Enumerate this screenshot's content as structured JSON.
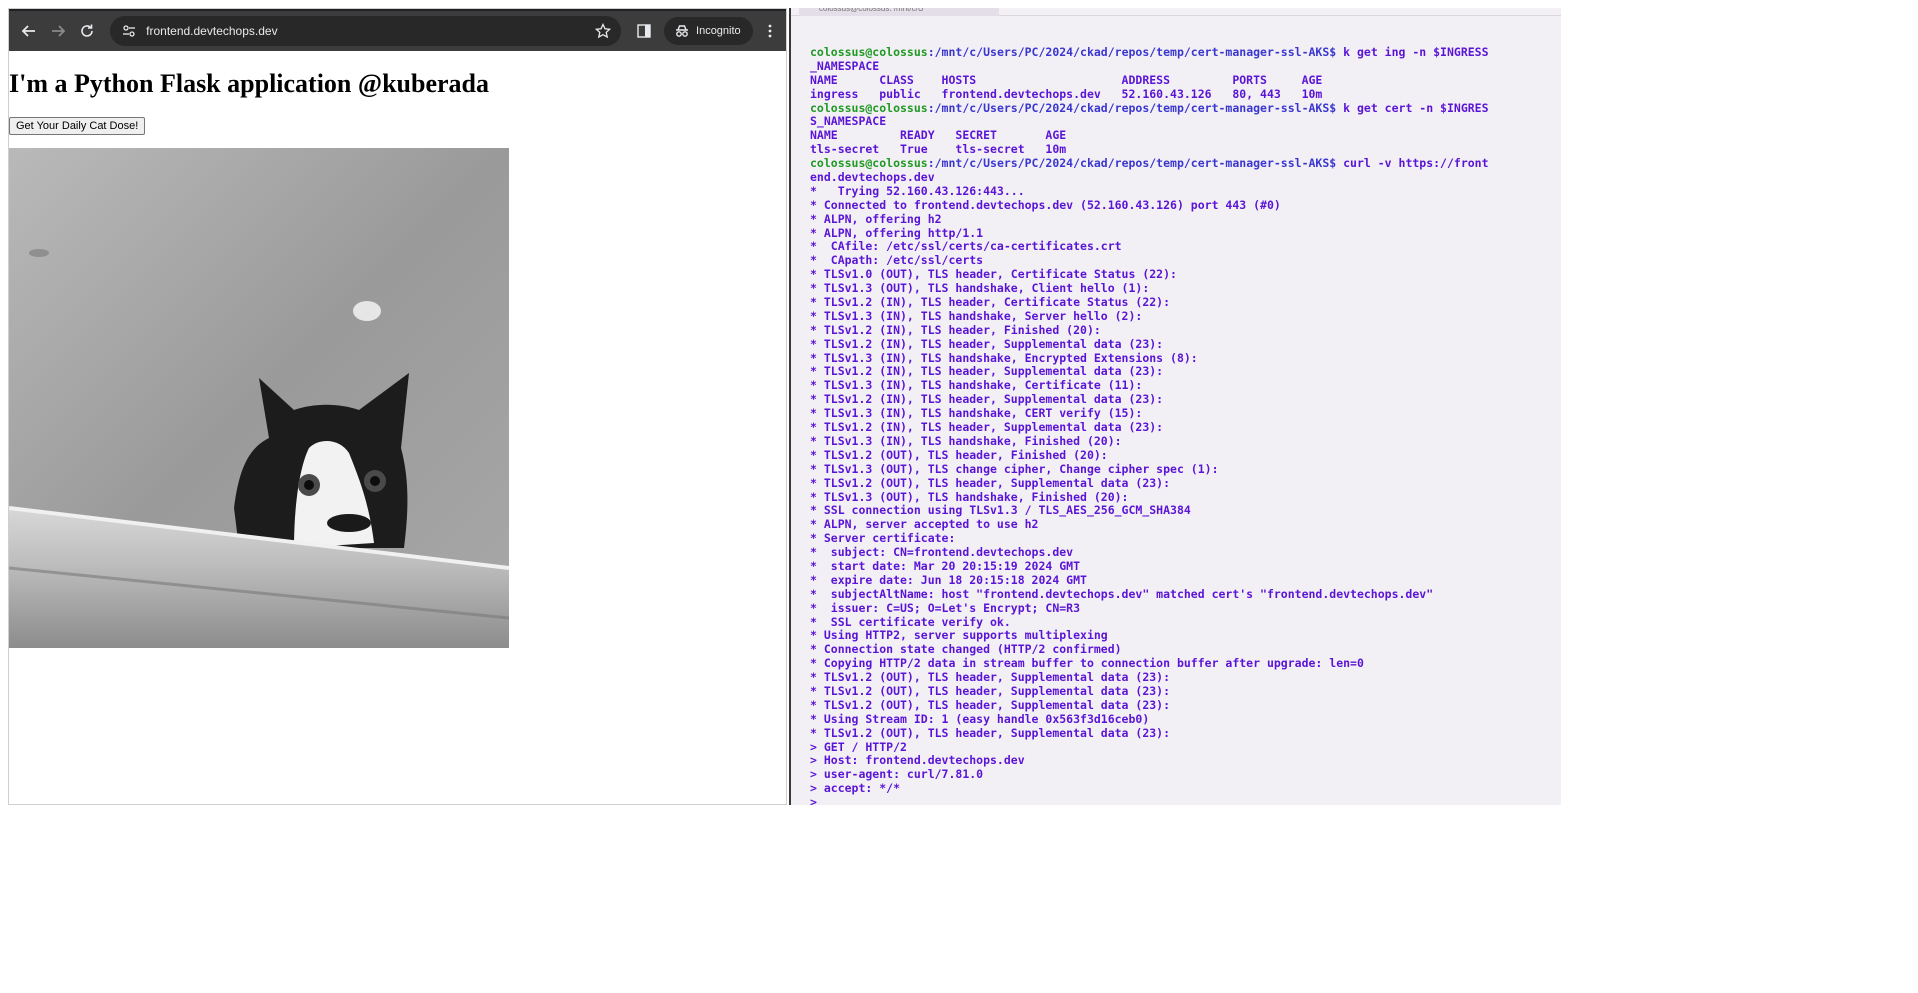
{
  "browser": {
    "url": "frontend.devtechops.dev",
    "mode_label": "Incognito",
    "page": {
      "heading": "I'm a Python Flask application @kuberada",
      "button_label": "Get Your Daily Cat Dose!"
    }
  },
  "terminal": {
    "tab_title": "colossus@colossus: /mnt/c/U",
    "prompt_user": "colossus@colossus",
    "lines": [
      {
        "kind": "prompt",
        "path": ":/mnt/c/Users/PC/2024/ckad/repos/temp/cert-manager-ssl-AKS$",
        "cmd": " k get ing -n $INGRESS"
      },
      {
        "kind": "text",
        "text": "_NAMESPACE"
      },
      {
        "kind": "text",
        "text": "NAME      CLASS    HOSTS                     ADDRESS         PORTS     AGE"
      },
      {
        "kind": "text",
        "text": "ingress   public   frontend.devtechops.dev   52.160.43.126   80, 443   10m"
      },
      {
        "kind": "prompt",
        "path": ":/mnt/c/Users/PC/2024/ckad/repos/temp/cert-manager-ssl-AKS$",
        "cmd": " k get cert -n $INGRES"
      },
      {
        "kind": "text",
        "text": "S_NAMESPACE"
      },
      {
        "kind": "text",
        "text": "NAME         READY   SECRET       AGE"
      },
      {
        "kind": "text",
        "text": "tls-secret   True    tls-secret   10m"
      },
      {
        "kind": "prompt",
        "path": ":/mnt/c/Users/PC/2024/ckad/repos/temp/cert-manager-ssl-AKS$",
        "cmd": " curl -v https://front"
      },
      {
        "kind": "text",
        "text": "end.devtechops.dev"
      },
      {
        "kind": "text",
        "text": "*   Trying 52.160.43.126:443..."
      },
      {
        "kind": "text",
        "text": "* Connected to frontend.devtechops.dev (52.160.43.126) port 443 (#0)"
      },
      {
        "kind": "text",
        "text": "* ALPN, offering h2"
      },
      {
        "kind": "text",
        "text": "* ALPN, offering http/1.1"
      },
      {
        "kind": "text",
        "text": "*  CAfile: /etc/ssl/certs/ca-certificates.crt"
      },
      {
        "kind": "text",
        "text": "*  CApath: /etc/ssl/certs"
      },
      {
        "kind": "text",
        "text": "* TLSv1.0 (OUT), TLS header, Certificate Status (22):"
      },
      {
        "kind": "text",
        "text": "* TLSv1.3 (OUT), TLS handshake, Client hello (1):"
      },
      {
        "kind": "text",
        "text": "* TLSv1.2 (IN), TLS header, Certificate Status (22):"
      },
      {
        "kind": "text",
        "text": "* TLSv1.3 (IN), TLS handshake, Server hello (2):"
      },
      {
        "kind": "text",
        "text": "* TLSv1.2 (IN), TLS header, Finished (20):"
      },
      {
        "kind": "text",
        "text": "* TLSv1.2 (IN), TLS header, Supplemental data (23):"
      },
      {
        "kind": "text",
        "text": "* TLSv1.3 (IN), TLS handshake, Encrypted Extensions (8):"
      },
      {
        "kind": "text",
        "text": "* TLSv1.2 (IN), TLS header, Supplemental data (23):"
      },
      {
        "kind": "text",
        "text": "* TLSv1.3 (IN), TLS handshake, Certificate (11):"
      },
      {
        "kind": "text",
        "text": "* TLSv1.2 (IN), TLS header, Supplemental data (23):"
      },
      {
        "kind": "text",
        "text": "* TLSv1.3 (IN), TLS handshake, CERT verify (15):"
      },
      {
        "kind": "text",
        "text": "* TLSv1.2 (IN), TLS header, Supplemental data (23):"
      },
      {
        "kind": "text",
        "text": "* TLSv1.3 (IN), TLS handshake, Finished (20):"
      },
      {
        "kind": "text",
        "text": "* TLSv1.2 (OUT), TLS header, Finished (20):"
      },
      {
        "kind": "text",
        "text": "* TLSv1.3 (OUT), TLS change cipher, Change cipher spec (1):"
      },
      {
        "kind": "text",
        "text": "* TLSv1.2 (OUT), TLS header, Supplemental data (23):"
      },
      {
        "kind": "text",
        "text": "* TLSv1.3 (OUT), TLS handshake, Finished (20):"
      },
      {
        "kind": "text",
        "text": "* SSL connection using TLSv1.3 / TLS_AES_256_GCM_SHA384"
      },
      {
        "kind": "text",
        "text": "* ALPN, server accepted to use h2"
      },
      {
        "kind": "text",
        "text": "* Server certificate:"
      },
      {
        "kind": "text",
        "text": "*  subject: CN=frontend.devtechops.dev"
      },
      {
        "kind": "text",
        "text": "*  start date: Mar 20 20:15:19 2024 GMT"
      },
      {
        "kind": "text",
        "text": "*  expire date: Jun 18 20:15:18 2024 GMT"
      },
      {
        "kind": "text",
        "text": "*  subjectAltName: host \"frontend.devtechops.dev\" matched cert's \"frontend.devtechops.dev\""
      },
      {
        "kind": "text",
        "text": "*  issuer: C=US; O=Let's Encrypt; CN=R3"
      },
      {
        "kind": "text",
        "text": "*  SSL certificate verify ok."
      },
      {
        "kind": "text",
        "text": "* Using HTTP2, server supports multiplexing"
      },
      {
        "kind": "text",
        "text": "* Connection state changed (HTTP/2 confirmed)"
      },
      {
        "kind": "text",
        "text": "* Copying HTTP/2 data in stream buffer to connection buffer after upgrade: len=0"
      },
      {
        "kind": "text",
        "text": "* TLSv1.2 (OUT), TLS header, Supplemental data (23):"
      },
      {
        "kind": "text",
        "text": "* TLSv1.2 (OUT), TLS header, Supplemental data (23):"
      },
      {
        "kind": "text",
        "text": "* TLSv1.2 (OUT), TLS header, Supplemental data (23):"
      },
      {
        "kind": "text",
        "text": "* Using Stream ID: 1 (easy handle 0x563f3d16ceb0)"
      },
      {
        "kind": "text",
        "text": "* TLSv1.2 (OUT), TLS header, Supplemental data (23):"
      },
      {
        "kind": "text",
        "text": "> GET / HTTP/2"
      },
      {
        "kind": "text",
        "text": "> Host: frontend.devtechops.dev"
      },
      {
        "kind": "text",
        "text": "> user-agent: curl/7.81.0"
      },
      {
        "kind": "text",
        "text": "> accept: */*"
      },
      {
        "kind": "text",
        "text": ">"
      }
    ]
  },
  "colors": {
    "terminal_text": "#5a14d6",
    "prompt_user": "#1f9a24",
    "prompt_path": "#3a36d0",
    "browser_toolbar": "#3c3c3c",
    "terminal_bg": "#f3f0f5"
  },
  "icons": [
    "back-arrow-icon",
    "forward-arrow-icon",
    "reload-icon",
    "site-settings-icon",
    "star-icon",
    "side-panel-icon",
    "incognito-icon",
    "kebab-menu-icon"
  ]
}
